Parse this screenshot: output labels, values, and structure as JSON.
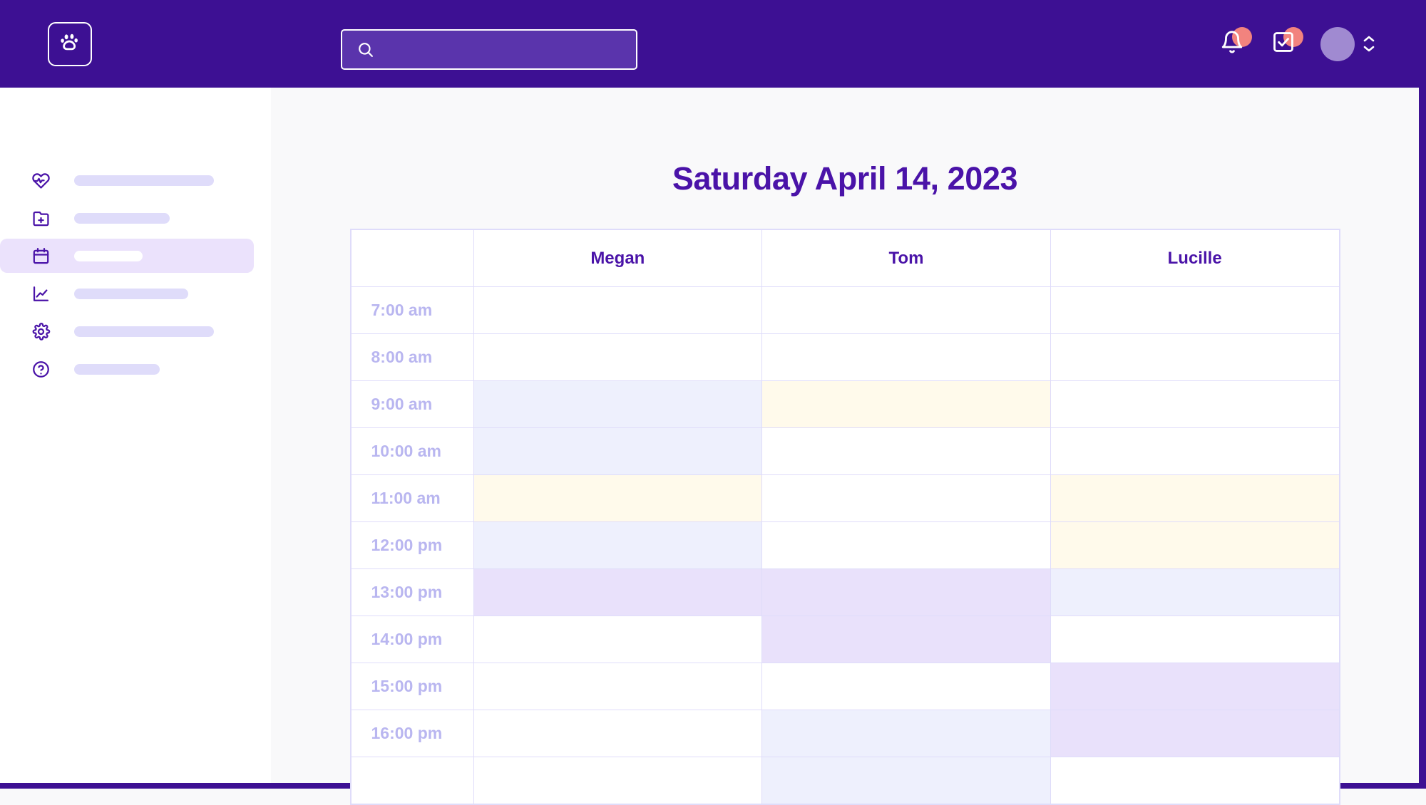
{
  "brand": {
    "color": "#3d1093",
    "logo_icon": "paw-print-icon"
  },
  "header": {
    "search": {
      "value": "",
      "placeholder": "",
      "icon": "search-icon"
    },
    "notifications_icon": "bell-icon",
    "tasks_icon": "checkbox-check-icon",
    "avatar_icon": "avatar",
    "selector_icon": "chevron-up-down-icon",
    "notification_badge_color": "#f2837e"
  },
  "sidebar": {
    "items": [
      {
        "icon": "heart-pulse-icon",
        "label": "",
        "skeleton_width": 196,
        "active": false
      },
      {
        "icon": "folder-plus-icon",
        "label": "",
        "skeleton_width": 134,
        "active": false
      },
      {
        "icon": "calendar-icon",
        "label": "",
        "skeleton_width": 96,
        "active": true
      },
      {
        "icon": "line-chart-icon",
        "label": "",
        "skeleton_width": 160,
        "active": false
      },
      {
        "icon": "gear-icon",
        "label": "",
        "skeleton_width": 196,
        "active": false
      },
      {
        "icon": "question-circle-icon",
        "label": "",
        "skeleton_width": 120,
        "active": false
      }
    ]
  },
  "main": {
    "title": "Saturday April 14, 2023"
  },
  "schedule": {
    "corner_label": "",
    "columns": [
      "Megan",
      "Tom",
      "Lucille"
    ],
    "times": [
      "7:00 am",
      "8:00 am",
      "9:00 am",
      "10:00 am",
      "11:00 am",
      "12:00 pm",
      "13:00 pm",
      "14:00 pm",
      "15:00 pm",
      "16:00 pm",
      ""
    ],
    "cell_colors": {
      "empty": "#ffffff",
      "blue": "#eef0fd",
      "yellow": "#fffaeb",
      "purple": "#e9e1fb"
    },
    "cells": [
      [
        "empty",
        "empty",
        "empty"
      ],
      [
        "empty",
        "empty",
        "empty"
      ],
      [
        "blue",
        "yellow",
        "empty"
      ],
      [
        "blue",
        "empty",
        "empty"
      ],
      [
        "yellow",
        "empty",
        "yellow"
      ],
      [
        "blue",
        "empty",
        "yellow"
      ],
      [
        "purple",
        "purple",
        "blue"
      ],
      [
        "empty",
        "purple",
        "empty"
      ],
      [
        "empty",
        "empty",
        "purple"
      ],
      [
        "empty",
        "blue",
        "purple"
      ],
      [
        "empty",
        "blue",
        "empty"
      ]
    ]
  }
}
